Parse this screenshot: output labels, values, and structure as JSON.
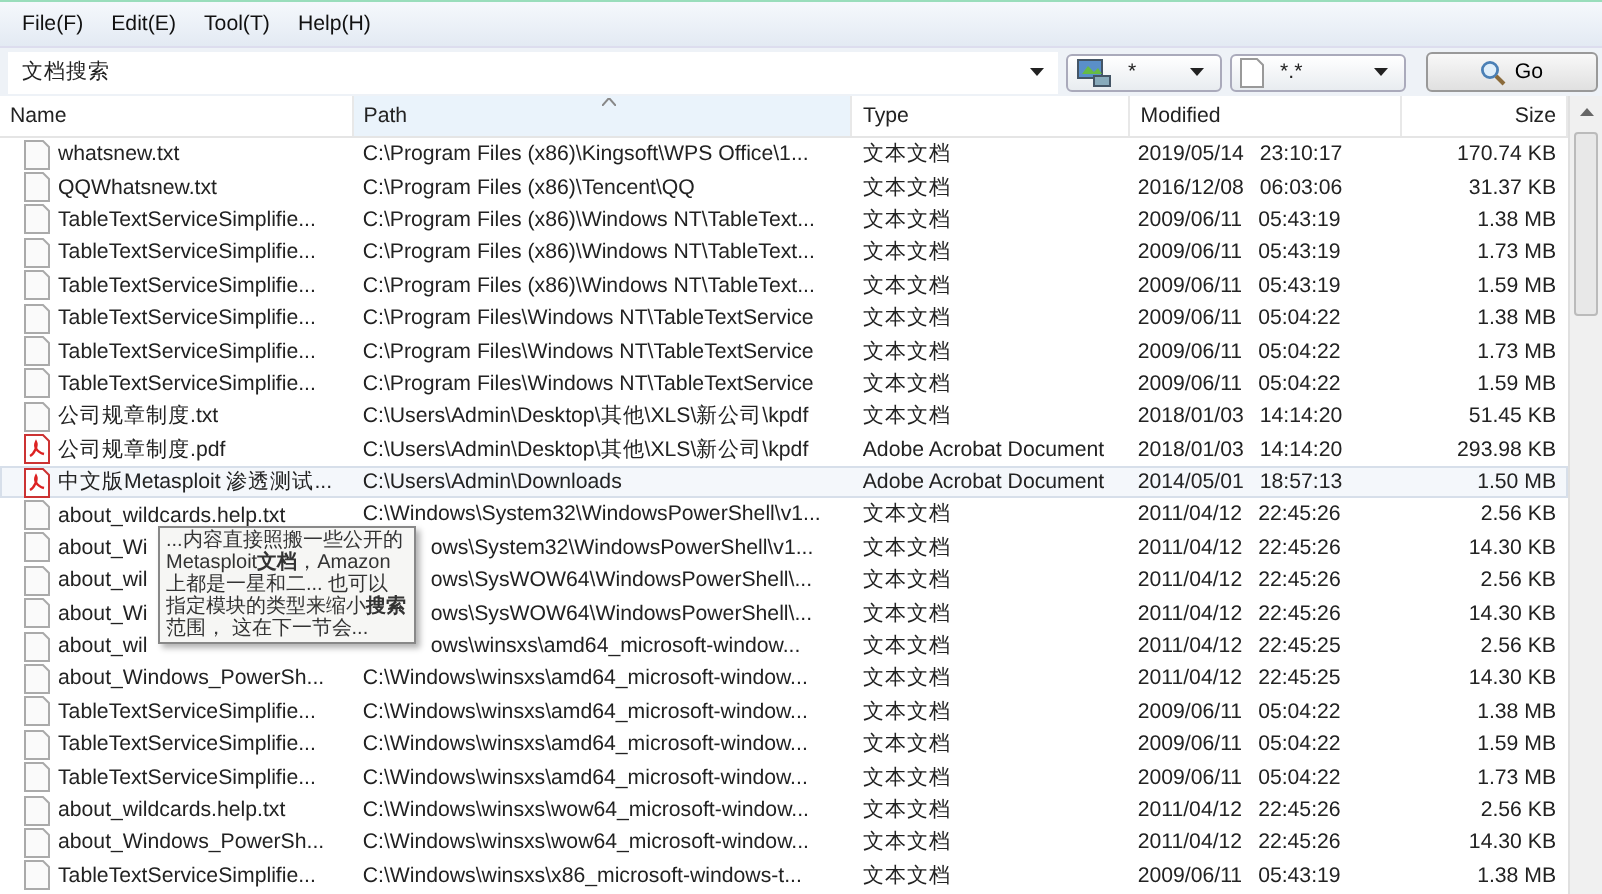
{
  "menu": [
    "File(F)",
    "Edit(E)",
    "Tool(T)",
    "Help(H)"
  ],
  "search": {
    "value": "文档搜索"
  },
  "drive_filter": {
    "value": "*"
  },
  "type_filter": {
    "value": "*.*"
  },
  "go_button": "Go",
  "table": {
    "columns": [
      {
        "label": "Name",
        "sorted": false
      },
      {
        "label": "Path",
        "sorted": true
      },
      {
        "label": "Type",
        "sorted": false
      },
      {
        "label": "Modified",
        "sorted": false
      },
      {
        "label": "Size",
        "sorted": false
      }
    ],
    "rows": [
      {
        "kind": "txt",
        "selected": false,
        "under_tooltip": false,
        "name": "whatsnew.txt",
        "path": "C:\\Program Files (x86)\\Kingsoft\\WPS Office\\1...",
        "type": "文本文档",
        "date": "2019/05/14",
        "time": "23:10:17",
        "size": "170.74 KB"
      },
      {
        "kind": "txt",
        "selected": false,
        "under_tooltip": false,
        "name": "QQWhatsnew.txt",
        "path": "C:\\Program Files (x86)\\Tencent\\QQ",
        "type": "文本文档",
        "date": "2016/12/08",
        "time": "06:03:06",
        "size": "31.37 KB"
      },
      {
        "kind": "txt",
        "selected": false,
        "under_tooltip": false,
        "name": "TableTextServiceSimplifie...",
        "path": "C:\\Program Files (x86)\\Windows NT\\TableText...",
        "type": "文本文档",
        "date": "2009/06/11",
        "time": "05:43:19",
        "size": "1.38 MB"
      },
      {
        "kind": "txt",
        "selected": false,
        "under_tooltip": false,
        "name": "TableTextServiceSimplifie...",
        "path": "C:\\Program Files (x86)\\Windows NT\\TableText...",
        "type": "文本文档",
        "date": "2009/06/11",
        "time": "05:43:19",
        "size": "1.73 MB"
      },
      {
        "kind": "txt",
        "selected": false,
        "under_tooltip": false,
        "name": "TableTextServiceSimplifie...",
        "path": "C:\\Program Files (x86)\\Windows NT\\TableText...",
        "type": "文本文档",
        "date": "2009/06/11",
        "time": "05:43:19",
        "size": "1.59 MB"
      },
      {
        "kind": "txt",
        "selected": false,
        "under_tooltip": false,
        "name": "TableTextServiceSimplifie...",
        "path": "C:\\Program Files\\Windows NT\\TableTextService",
        "type": "文本文档",
        "date": "2009/06/11",
        "time": "05:04:22",
        "size": "1.38 MB"
      },
      {
        "kind": "txt",
        "selected": false,
        "under_tooltip": false,
        "name": "TableTextServiceSimplifie...",
        "path": "C:\\Program Files\\Windows NT\\TableTextService",
        "type": "文本文档",
        "date": "2009/06/11",
        "time": "05:04:22",
        "size": "1.73 MB"
      },
      {
        "kind": "txt",
        "selected": false,
        "under_tooltip": false,
        "name": "TableTextServiceSimplifie...",
        "path": "C:\\Program Files\\Windows NT\\TableTextService",
        "type": "文本文档",
        "date": "2009/06/11",
        "time": "05:04:22",
        "size": "1.59 MB"
      },
      {
        "kind": "txt",
        "selected": false,
        "under_tooltip": false,
        "name": "公司规章制度.txt",
        "path": "C:\\Users\\Admin\\Desktop\\其他\\XLS\\新公司\\kpdf",
        "type": "文本文档",
        "date": "2018/01/03",
        "time": "14:14:20",
        "size": "51.45 KB"
      },
      {
        "kind": "pdf",
        "selected": false,
        "under_tooltip": false,
        "name": "公司规章制度.pdf",
        "path": "C:\\Users\\Admin\\Desktop\\其他\\XLS\\新公司\\kpdf",
        "type": "Adobe Acrobat Document",
        "date": "2018/01/03",
        "time": "14:14:20",
        "size": "293.98 KB"
      },
      {
        "kind": "pdf",
        "selected": true,
        "under_tooltip": false,
        "name": "中文版Metasploit 渗透测试...",
        "path": "C:\\Users\\Admin\\Downloads",
        "type": "Adobe Acrobat Document",
        "date": "2014/05/01",
        "time": "18:57:13",
        "size": "1.50 MB"
      },
      {
        "kind": "txt",
        "selected": false,
        "under_tooltip": false,
        "name": "about_wildcards.help.txt",
        "path": "C:\\Windows\\System32\\WindowsPowerShell\\v1...",
        "type": "文本文档",
        "date": "2011/04/12",
        "time": "22:45:26",
        "size": "2.56 KB"
      },
      {
        "kind": "txt",
        "selected": false,
        "under_tooltip": true,
        "name": "about_Wi",
        "path": "ows\\System32\\WindowsPowerShell\\v1...",
        "type": "文本文档",
        "date": "2011/04/12",
        "time": "22:45:26",
        "size": "14.30 KB"
      },
      {
        "kind": "txt",
        "selected": false,
        "under_tooltip": true,
        "name": "about_wil",
        "path": "ows\\SysWOW64\\WindowsPowerShell\\...",
        "type": "文本文档",
        "date": "2011/04/12",
        "time": "22:45:26",
        "size": "2.56 KB"
      },
      {
        "kind": "txt",
        "selected": false,
        "under_tooltip": true,
        "name": "about_Wi",
        "path": "ows\\SysWOW64\\WindowsPowerShell\\...",
        "type": "文本文档",
        "date": "2011/04/12",
        "time": "22:45:26",
        "size": "14.30 KB"
      },
      {
        "kind": "txt",
        "selected": false,
        "under_tooltip": true,
        "name": "about_wil",
        "path": "ows\\winsxs\\amd64_microsoft-window...",
        "type": "文本文档",
        "date": "2011/04/12",
        "time": "22:45:25",
        "size": "2.56 KB"
      },
      {
        "kind": "txt",
        "selected": false,
        "under_tooltip": false,
        "name": "about_Windows_PowerSh...",
        "path": "C:\\Windows\\winsxs\\amd64_microsoft-window...",
        "type": "文本文档",
        "date": "2011/04/12",
        "time": "22:45:25",
        "size": "14.30 KB"
      },
      {
        "kind": "txt",
        "selected": false,
        "under_tooltip": false,
        "name": "TableTextServiceSimplifie...",
        "path": "C:\\Windows\\winsxs\\amd64_microsoft-window...",
        "type": "文本文档",
        "date": "2009/06/11",
        "time": "05:04:22",
        "size": "1.38 MB"
      },
      {
        "kind": "txt",
        "selected": false,
        "under_tooltip": false,
        "name": "TableTextServiceSimplifie...",
        "path": "C:\\Windows\\winsxs\\amd64_microsoft-window...",
        "type": "文本文档",
        "date": "2009/06/11",
        "time": "05:04:22",
        "size": "1.59 MB"
      },
      {
        "kind": "txt",
        "selected": false,
        "under_tooltip": false,
        "name": "TableTextServiceSimplifie...",
        "path": "C:\\Windows\\winsxs\\amd64_microsoft-window...",
        "type": "文本文档",
        "date": "2009/06/11",
        "time": "05:04:22",
        "size": "1.73 MB"
      },
      {
        "kind": "txt",
        "selected": false,
        "under_tooltip": false,
        "name": "about_wildcards.help.txt",
        "path": "C:\\Windows\\winsxs\\wow64_microsoft-window...",
        "type": "文本文档",
        "date": "2011/04/12",
        "time": "22:45:26",
        "size": "2.56 KB"
      },
      {
        "kind": "txt",
        "selected": false,
        "under_tooltip": false,
        "name": "about_Windows_PowerSh...",
        "path": "C:\\Windows\\winsxs\\wow64_microsoft-window...",
        "type": "文本文档",
        "date": "2011/04/12",
        "time": "22:45:26",
        "size": "14.30 KB"
      },
      {
        "kind": "txt",
        "selected": false,
        "under_tooltip": false,
        "name": "TableTextServiceSimplifie...",
        "path": "C:\\Windows\\winsxs\\x86_microsoft-windows-t...",
        "type": "文本文档",
        "date": "2009/06/11",
        "time": "05:43:19",
        "size": "1.38 MB"
      }
    ]
  },
  "tooltip": {
    "text": "...内容直接照搬一些公开的 Metasploit**文档**，Amazon上都是一星和二... 也可以指定模块的类型来缩小**搜索**范围， 这在下一节会..."
  }
}
